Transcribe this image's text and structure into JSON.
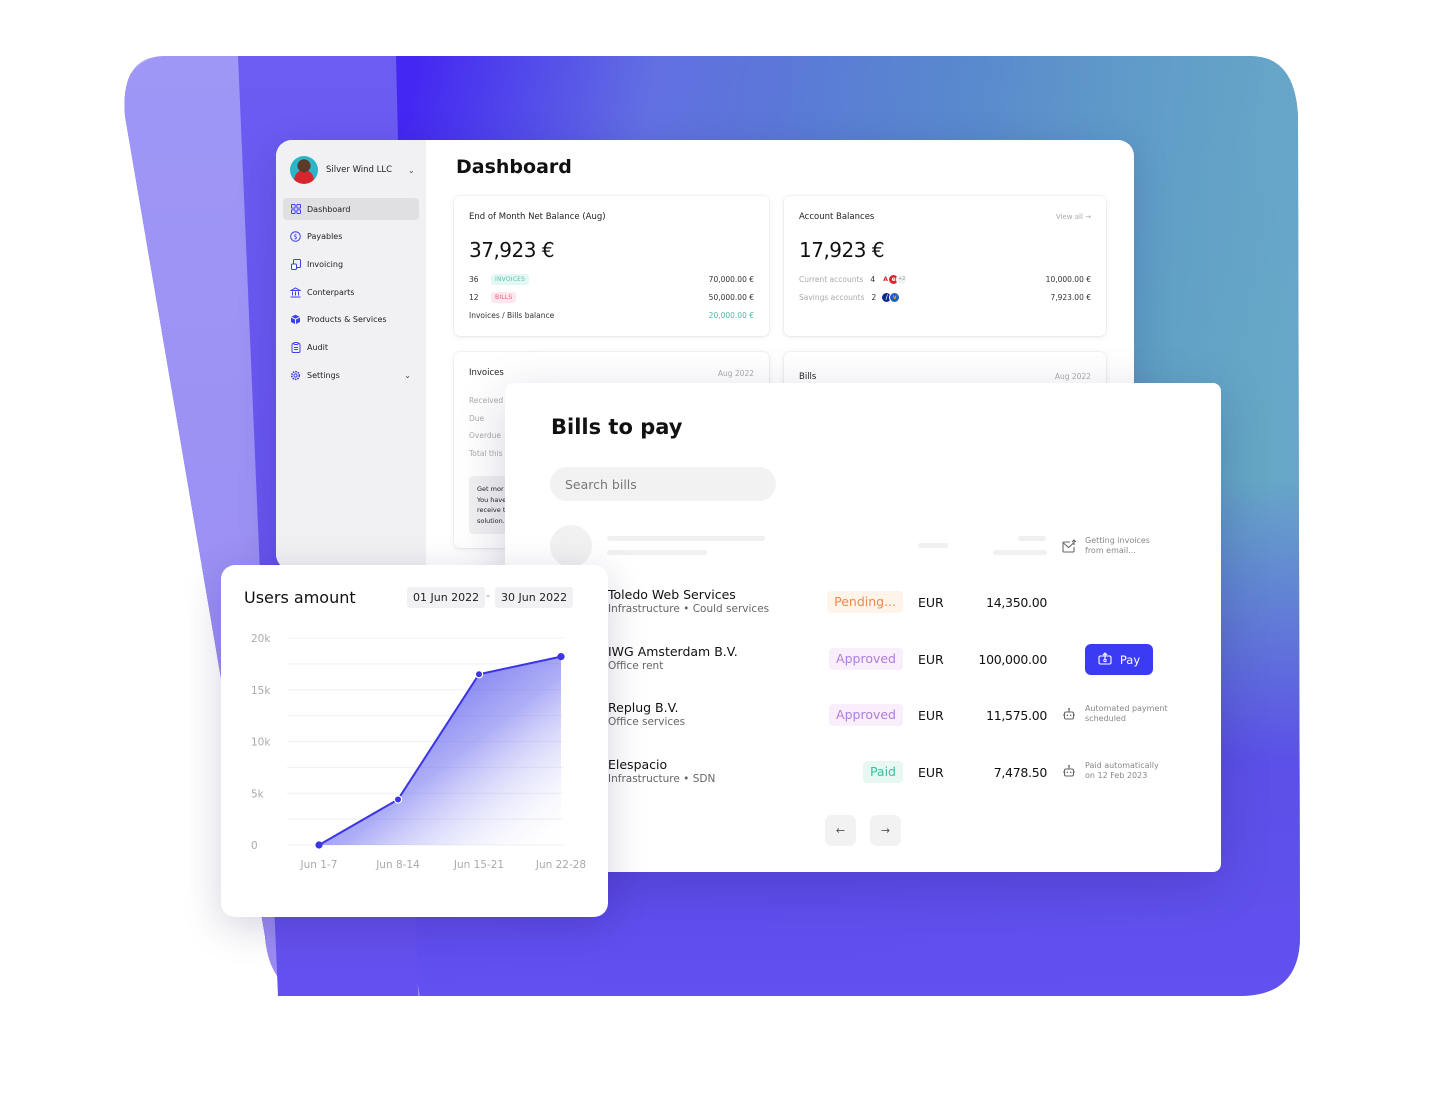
{
  "sidebar": {
    "org_name": "Silver Wind LLC",
    "items": [
      {
        "label": "Dashboard",
        "icon": "grid-icon",
        "active": true
      },
      {
        "label": "Payables",
        "icon": "dollar-circle-icon"
      },
      {
        "label": "Invoicing",
        "icon": "invoice-icon"
      },
      {
        "label": "Conterparts",
        "icon": "bank-icon"
      },
      {
        "label": "Products & Services",
        "icon": "box-icon"
      },
      {
        "label": "Audit",
        "icon": "clipboard-icon"
      },
      {
        "label": "Settings",
        "icon": "gear-icon",
        "expandable": true
      }
    ]
  },
  "dashboard": {
    "title": "Dashboard",
    "net_balance": {
      "title": "End of Month Net Balance (Aug)",
      "amount": "37,923 €",
      "rows": [
        {
          "count": "36",
          "tag": "INVOICES",
          "value": "70,000.00 €"
        },
        {
          "count": "12",
          "tag": "BILLS",
          "value": "50,000.00 €"
        }
      ],
      "balance_label": "Invoices / Bills balance",
      "balance_value": "20,000.00 €"
    },
    "account_balances": {
      "title": "Account Balances",
      "view_all": "View all →",
      "amount": "17,923 €",
      "rows": [
        {
          "label": "Current accounts",
          "count": "4",
          "extra": "+2",
          "value": "10,000.00 €"
        },
        {
          "label": "Savings accounts",
          "count": "2",
          "value": "7,923.00 €"
        }
      ]
    },
    "invoices": {
      "title": "Invoices",
      "date": "Aug 2022",
      "rows": [
        "Received",
        "Due",
        "Overdue",
        "Total this"
      ],
      "promo": [
        "Get mor",
        "You have",
        "receive t",
        "solution."
      ]
    },
    "bills": {
      "title": "Bills",
      "date": "Aug 2022"
    }
  },
  "bills_to_pay": {
    "title": "Bills to pay",
    "search_placeholder": "Search bills",
    "email_note": [
      "Getting invoices",
      "from email..."
    ],
    "rows": [
      {
        "name": "Toledo Web Services",
        "category": "Infrastructure • Could services",
        "status": "Pending...",
        "status_type": "pending",
        "currency": "EUR",
        "amount": "14,350.00"
      },
      {
        "name": "IWG Amsterdam B.V.",
        "category": "Office rent",
        "status": "Approved",
        "status_type": "approved",
        "currency": "EUR",
        "amount": "100,000.00",
        "action": "Pay"
      },
      {
        "name": "Replug B.V.",
        "category": "Office services",
        "status": "Approved",
        "status_type": "approved",
        "currency": "EUR",
        "amount": "11,575.00",
        "note": [
          "Automated payment",
          "scheduled"
        ]
      },
      {
        "name": "Elespacio",
        "category": "Infrastructure • SDN",
        "status": "Paid",
        "status_type": "paid",
        "currency": "EUR",
        "amount": "7,478.50",
        "note": [
          "Paid automatically",
          "on 12 Feb 2023"
        ]
      }
    ],
    "pager": {
      "prev": "←",
      "next": "→"
    }
  },
  "users_chart": {
    "date_from": "01 Jun 2022",
    "date_sep": "-",
    "date_to": "30 Jun 2022"
  },
  "chart_data": {
    "type": "area",
    "title": "Users amount",
    "xlabel": "",
    "ylabel": "",
    "categories": [
      "Jun 1-7",
      "Jun 8-14",
      "Jun 15-21",
      "Jun 22-28"
    ],
    "values": [
      0,
      4400,
      16500,
      18200
    ],
    "yticks": [
      "0",
      "5k",
      "10k",
      "15k",
      "20k"
    ],
    "ylim": [
      0,
      20000
    ],
    "grid": true,
    "color": "#3b35e6"
  },
  "colors": {
    "accent": "#3b3bf4",
    "pending": "#ee8a4a",
    "approved": "#b27cdb",
    "paid": "#3dbd9e",
    "teal": "#4fb7ac"
  }
}
